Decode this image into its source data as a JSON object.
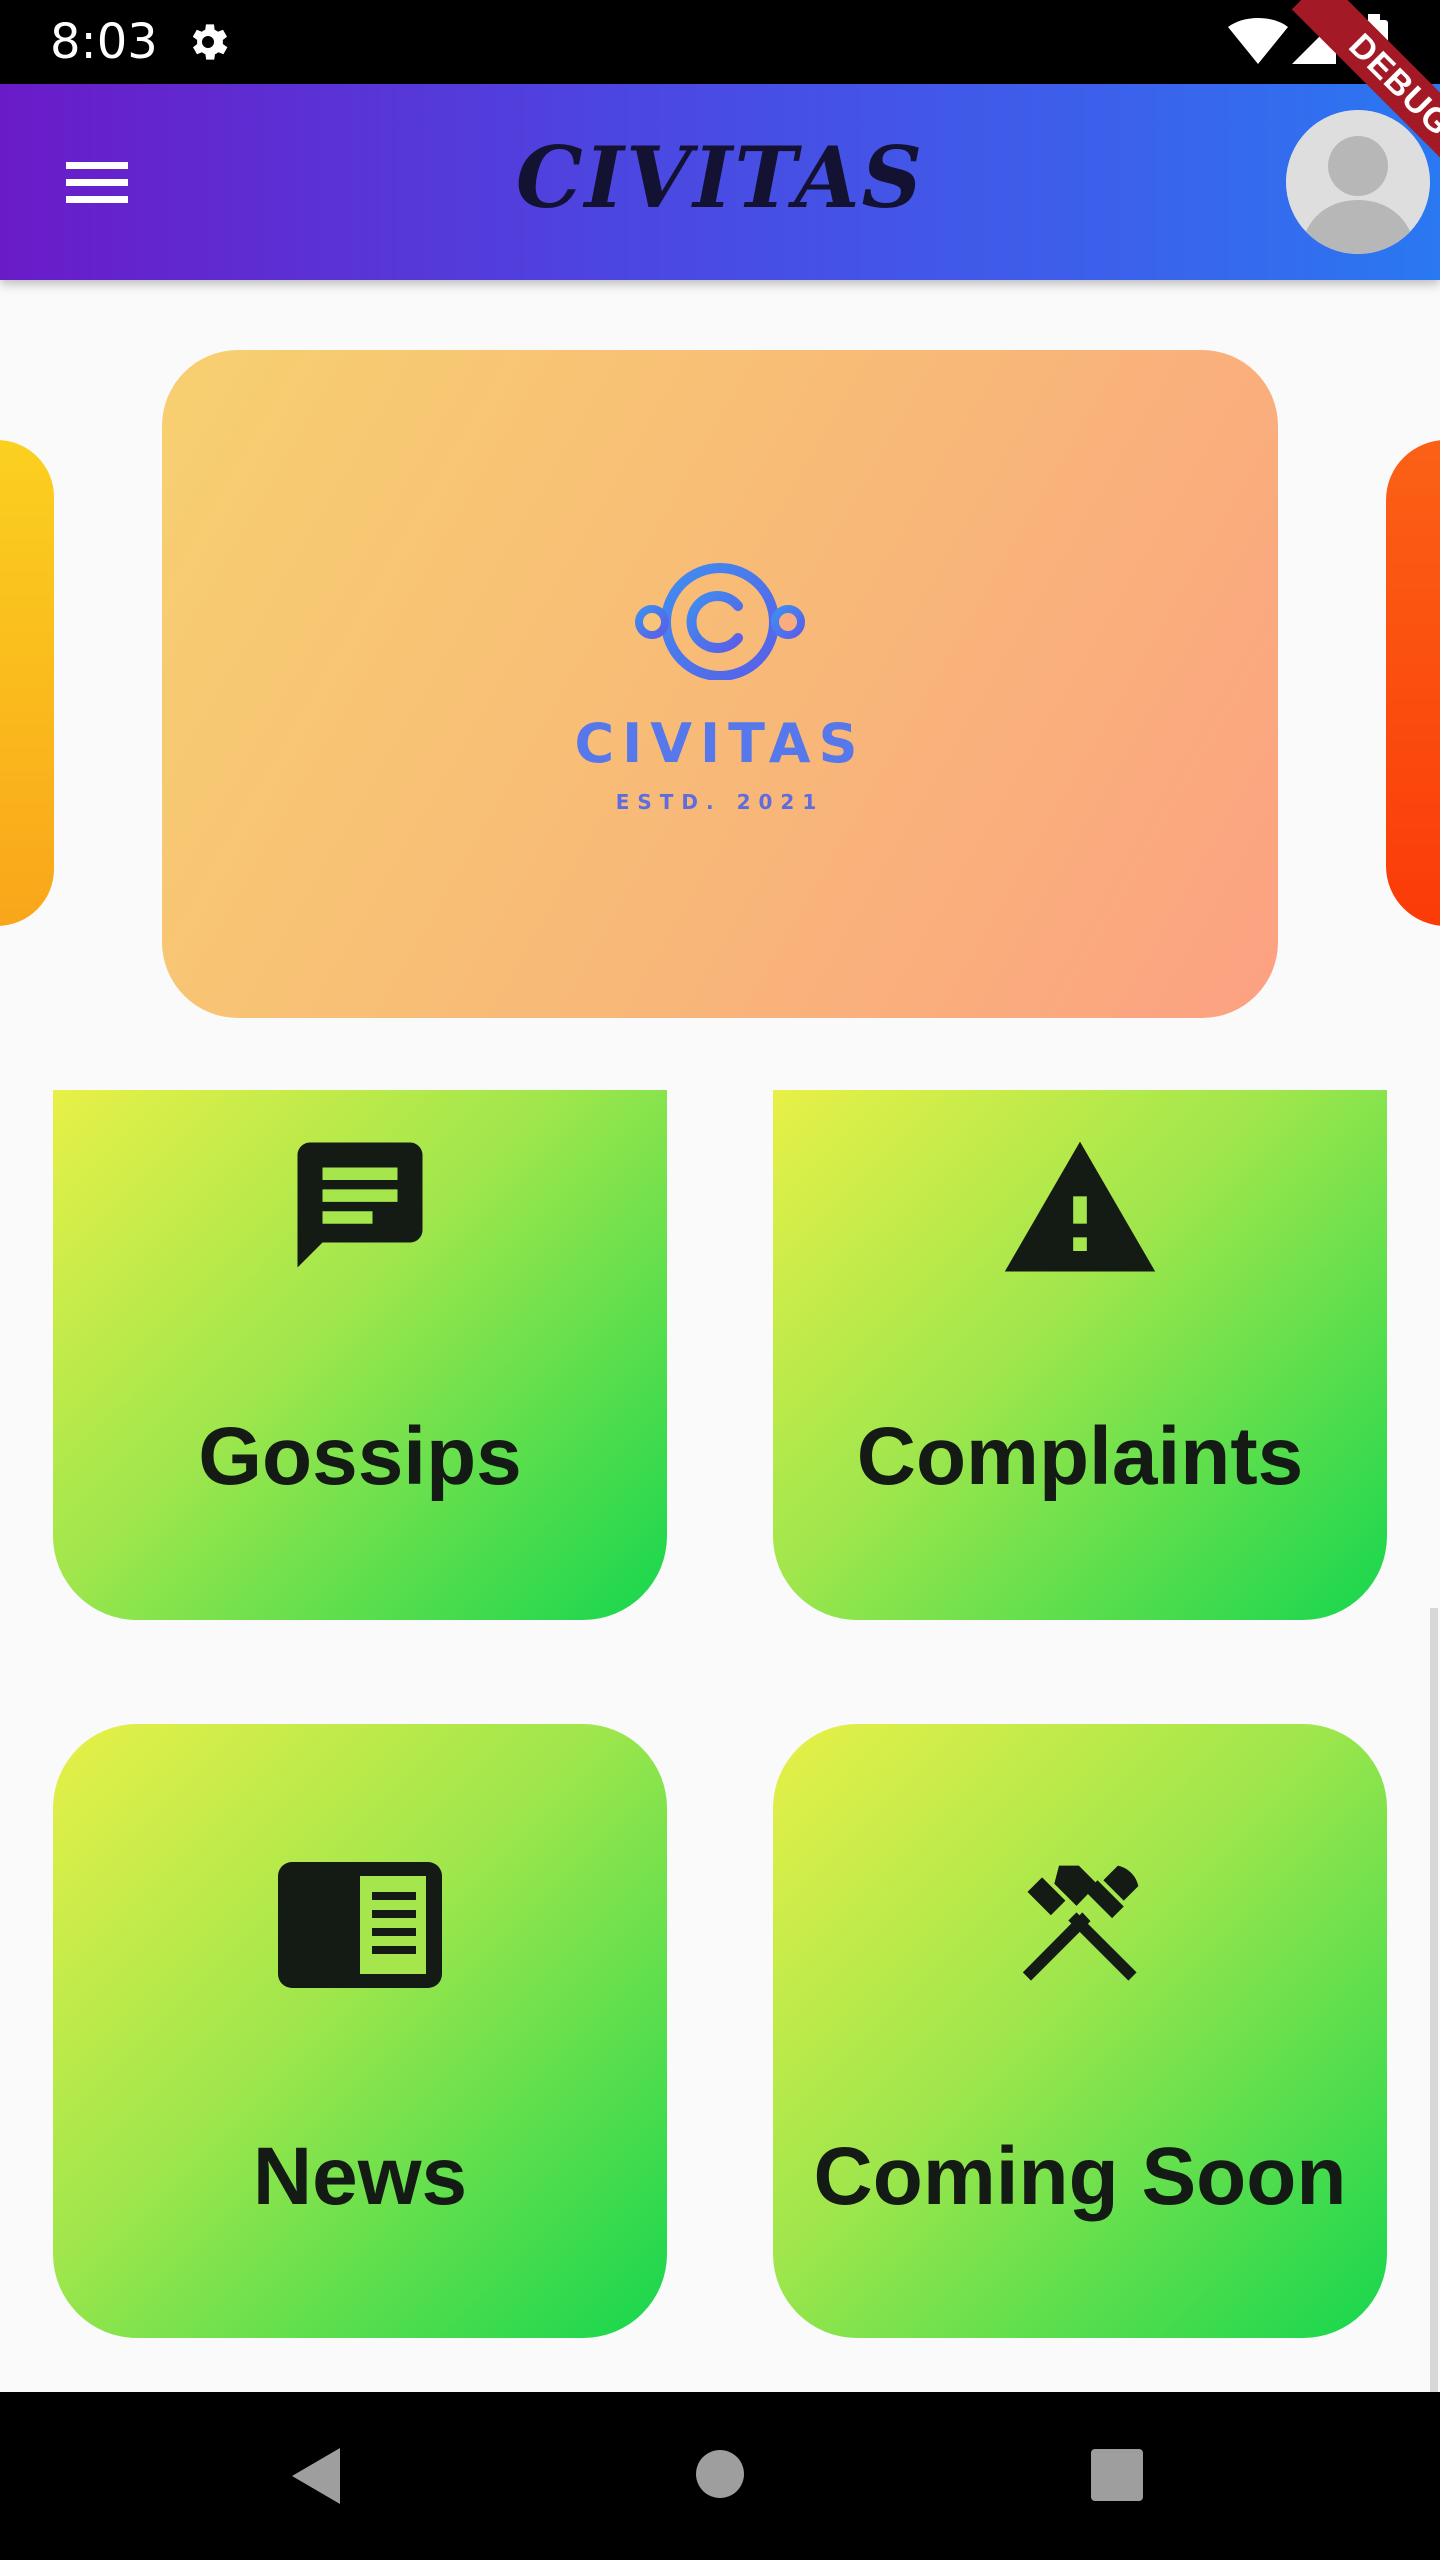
{
  "status_bar": {
    "time": "8:03",
    "icons": [
      "gear-icon",
      "wifi-icon",
      "cellular-signal-icon",
      "battery-icon"
    ]
  },
  "app_bar": {
    "title": "CIVITAS",
    "menu_icon": "menu-icon",
    "avatar_icon": "avatar-icon",
    "debug_label": "DEBUG",
    "gradient_colors": [
      "#6a1bc8",
      "#2a78f2"
    ]
  },
  "carousel": {
    "logo_text": "CIVITAS",
    "logo_sub": "ESTD. 2021",
    "logo_color": "#5678ea",
    "card_colors": [
      "#f7d070",
      "#fca182"
    ],
    "left_card_colors": [
      "#fbd01f",
      "#f9a61a"
    ],
    "right_card_colors": [
      "#fb6116",
      "#fb3b08"
    ]
  },
  "tiles": [
    {
      "label": "Gossips",
      "icon": "chat-message-icon"
    },
    {
      "label": "Complaints",
      "icon": "warning-icon"
    },
    {
      "label": "News",
      "icon": "newspaper-icon"
    },
    {
      "label": "Coming Soon",
      "icon": "tools-icon"
    }
  ],
  "tile_colors": [
    "#e8f048",
    "#16d64e"
  ],
  "nav_bar": {
    "icons": [
      "back-icon",
      "home-icon",
      "recents-icon"
    ]
  }
}
